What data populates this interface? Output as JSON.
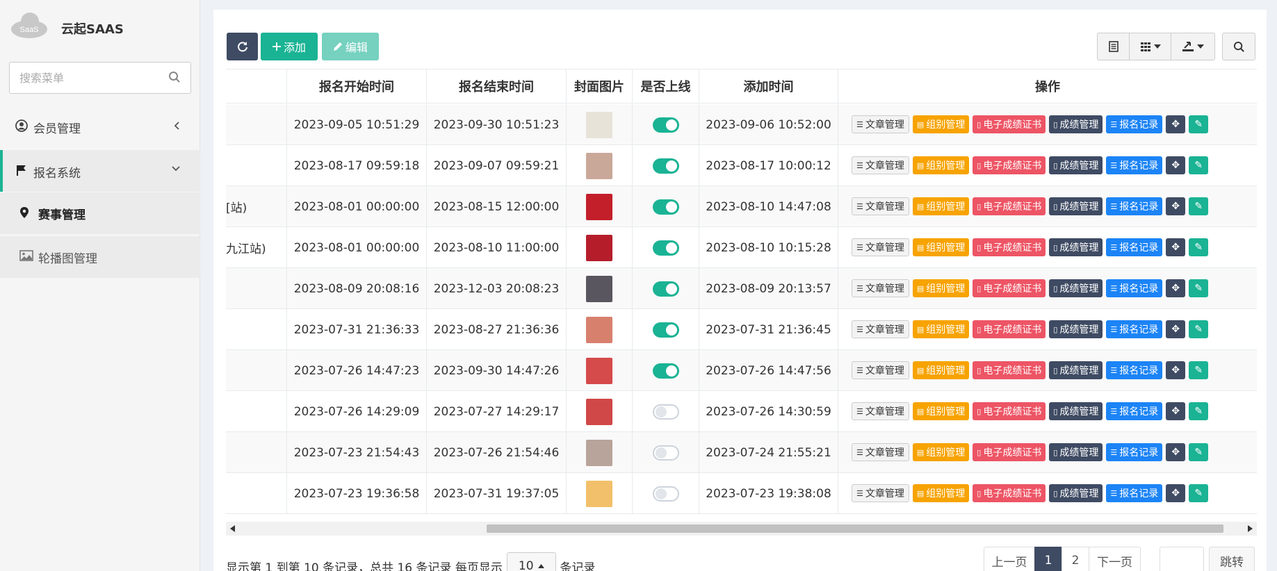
{
  "brand": {
    "logo_text": "SaaS",
    "title": "云起SAAS"
  },
  "search": {
    "placeholder": "搜索菜单"
  },
  "sidebar": {
    "items": [
      {
        "label": "会员管理",
        "icon": "user-circle-icon"
      },
      {
        "label": "报名系统",
        "icon": "flag-icon"
      },
      {
        "label": "赛事管理",
        "icon": "map-pin-icon"
      },
      {
        "label": "轮播图管理",
        "icon": "image-icon"
      }
    ]
  },
  "toolbar": {
    "add_label": "添加",
    "edit_label": "编辑"
  },
  "table": {
    "headers": [
      "报名开始时间",
      "报名结束时间",
      "封面图片",
      "是否上线",
      "添加时间",
      "操作"
    ],
    "ops": [
      "文章管理",
      "组别管理",
      "电子成绩证书",
      "成绩管理",
      "报名记录"
    ],
    "rows": [
      {
        "name": "",
        "start": "2023-09-05 10:51:29",
        "end": "2023-09-30 10:51:23",
        "online": true,
        "added": "2023-09-06 10:52:00",
        "thumb": "#e8e3d8"
      },
      {
        "name": "",
        "start": "2023-08-17 09:59:18",
        "end": "2023-09-07 09:59:21",
        "online": true,
        "added": "2023-08-17 10:00:12",
        "thumb": "#c9a89a"
      },
      {
        "name": "[站)",
        "start": "2023-08-01 00:00:00",
        "end": "2023-08-15 12:00:00",
        "online": true,
        "added": "2023-08-10 14:47:08",
        "thumb": "#c21f2a"
      },
      {
        "name": "九江站)",
        "start": "2023-08-01 00:00:00",
        "end": "2023-08-10 11:00:00",
        "online": true,
        "added": "2023-08-10 10:15:28",
        "thumb": "#b51d2b"
      },
      {
        "name": "",
        "start": "2023-08-09 20:08:16",
        "end": "2023-12-03 20:08:23",
        "online": true,
        "added": "2023-08-09 20:13:57",
        "thumb": "#5a5660"
      },
      {
        "name": "",
        "start": "2023-07-31 21:36:33",
        "end": "2023-08-27 21:36:36",
        "online": true,
        "added": "2023-07-31 21:36:45",
        "thumb": "#d8806e"
      },
      {
        "name": "",
        "start": "2023-07-26 14:47:23",
        "end": "2023-09-30 14:47:26",
        "online": true,
        "added": "2023-07-26 14:47:56",
        "thumb": "#d54a4a"
      },
      {
        "name": "",
        "start": "2023-07-26 14:29:09",
        "end": "2023-07-27 14:29:17",
        "online": false,
        "added": "2023-07-26 14:30:59",
        "thumb": "#d04848"
      },
      {
        "name": "",
        "start": "2023-07-23 21:54:43",
        "end": "2023-07-26 21:54:46",
        "online": false,
        "added": "2023-07-24 21:55:21",
        "thumb": "#b8a49a"
      },
      {
        "name": "",
        "start": "2023-07-23 19:36:58",
        "end": "2023-07-31 19:37:05",
        "online": false,
        "added": "2023-07-23 19:38:08",
        "thumb": "#f2c06a"
      }
    ]
  },
  "pagination": {
    "info_prefix": "显示第 1 到第 10 条记录，总共 16 条记录 每页显示",
    "page_size": "10",
    "info_suffix": "条记录",
    "prev": "上一页",
    "next": "下一页",
    "pages": [
      "1",
      "2"
    ],
    "jump": "跳转"
  }
}
